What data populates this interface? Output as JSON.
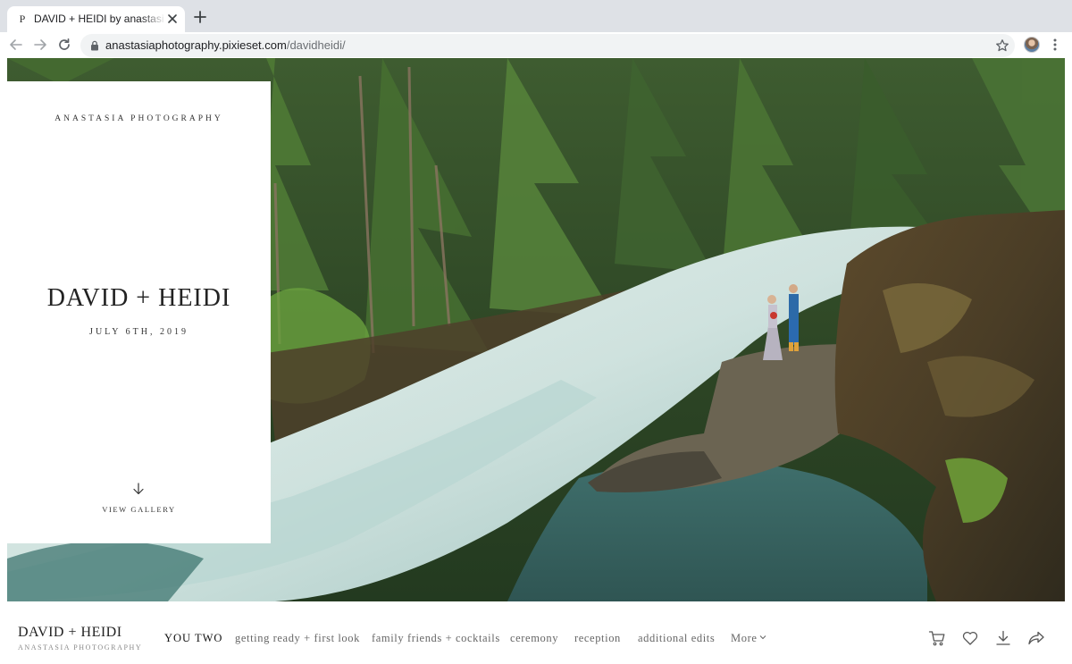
{
  "browser": {
    "tab_favicon": "P",
    "tab_title": "DAVID + HEIDI by anastasia photography",
    "url_host": "anastasiaphotography.pixieset.com",
    "url_path": "/davidheidi/"
  },
  "cover": {
    "studio_name": "ANASTASIA PHOTOGRAPHY",
    "couple_name": "DAVID + HEIDI",
    "date": "JULY 6TH, 2019",
    "view_gallery_label": "VIEW GALLERY",
    "photo_subject": "couple standing on a rock ledge above a rushing forest river"
  },
  "gallery_nav": {
    "title": "DAVID + HEIDI",
    "subtitle": "ANASTASIA PHOTOGRAPHY",
    "items": [
      {
        "label": "YOU TWO",
        "active": true
      },
      {
        "label": "getting ready + first look",
        "active": false
      },
      {
        "label": "family friends + cocktails",
        "active": false
      },
      {
        "label": "ceremony",
        "active": false
      },
      {
        "label": "reception",
        "active": false
      },
      {
        "label": "additional edits",
        "active": false
      }
    ],
    "more_label": "More",
    "actions": [
      "cart-icon",
      "heart-icon",
      "download-icon",
      "share-icon"
    ]
  },
  "colors": {
    "chrome_bg": "#dee1e6",
    "omnibox_bg": "#f1f3f4",
    "text_dark": "#222222",
    "text_muted": "#666666",
    "forest": "#2f4a2a",
    "water": "#cfe3e0"
  }
}
